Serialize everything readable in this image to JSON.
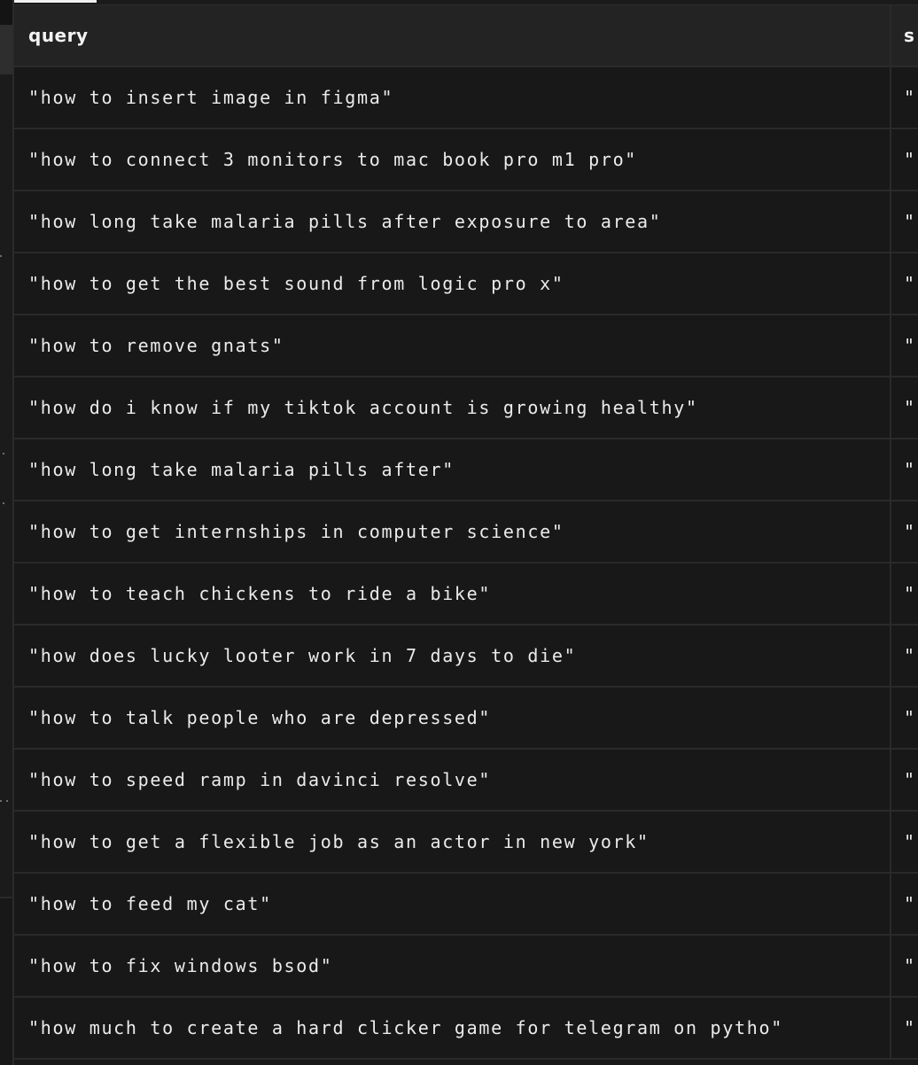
{
  "table": {
    "columns": [
      "query",
      "s"
    ],
    "rows": [
      {
        "query": "\"how to insert image in figma\"",
        "second": "\""
      },
      {
        "query": "\"how to connect 3 monitors to mac book pro m1 pro\"",
        "second": "\""
      },
      {
        "query": "\"how long take malaria pills after exposure to area\"",
        "second": "\""
      },
      {
        "query": "\"how to get the best sound from logic pro x\"",
        "second": "\""
      },
      {
        "query": "\"how to remove gnats\"",
        "second": "\""
      },
      {
        "query": "\"how do i know if my tiktok account is growing healthy\"",
        "second": "\""
      },
      {
        "query": "\"how long take malaria pills after\"",
        "second": "\""
      },
      {
        "query": "\"how to get internships in computer science\"",
        "second": "\""
      },
      {
        "query": "\"how to teach chickens to ride a bike\"",
        "second": "\""
      },
      {
        "query": "\"how does lucky looter work in 7 days to die\"",
        "second": "\""
      },
      {
        "query": "\"how to talk people who are depressed\"",
        "second": "\""
      },
      {
        "query": "\"how to speed ramp in davinci resolve\"",
        "second": "\""
      },
      {
        "query": "\"how to get a flexible job as an actor in new york\"",
        "second": "\""
      },
      {
        "query": "\"how to feed my cat\"",
        "second": "\""
      },
      {
        "query": "\"how to fix windows bsod\"",
        "second": "\""
      },
      {
        "query": "\"how much to create a hard clicker game for telegram on pytho\"",
        "second": "\""
      }
    ]
  },
  "colors": {
    "background": "#181818",
    "header_background": "#232323",
    "grid_line": "#2a2a2a",
    "text": "#ebebeb",
    "active_tab_indicator": "#f0f0f0"
  }
}
